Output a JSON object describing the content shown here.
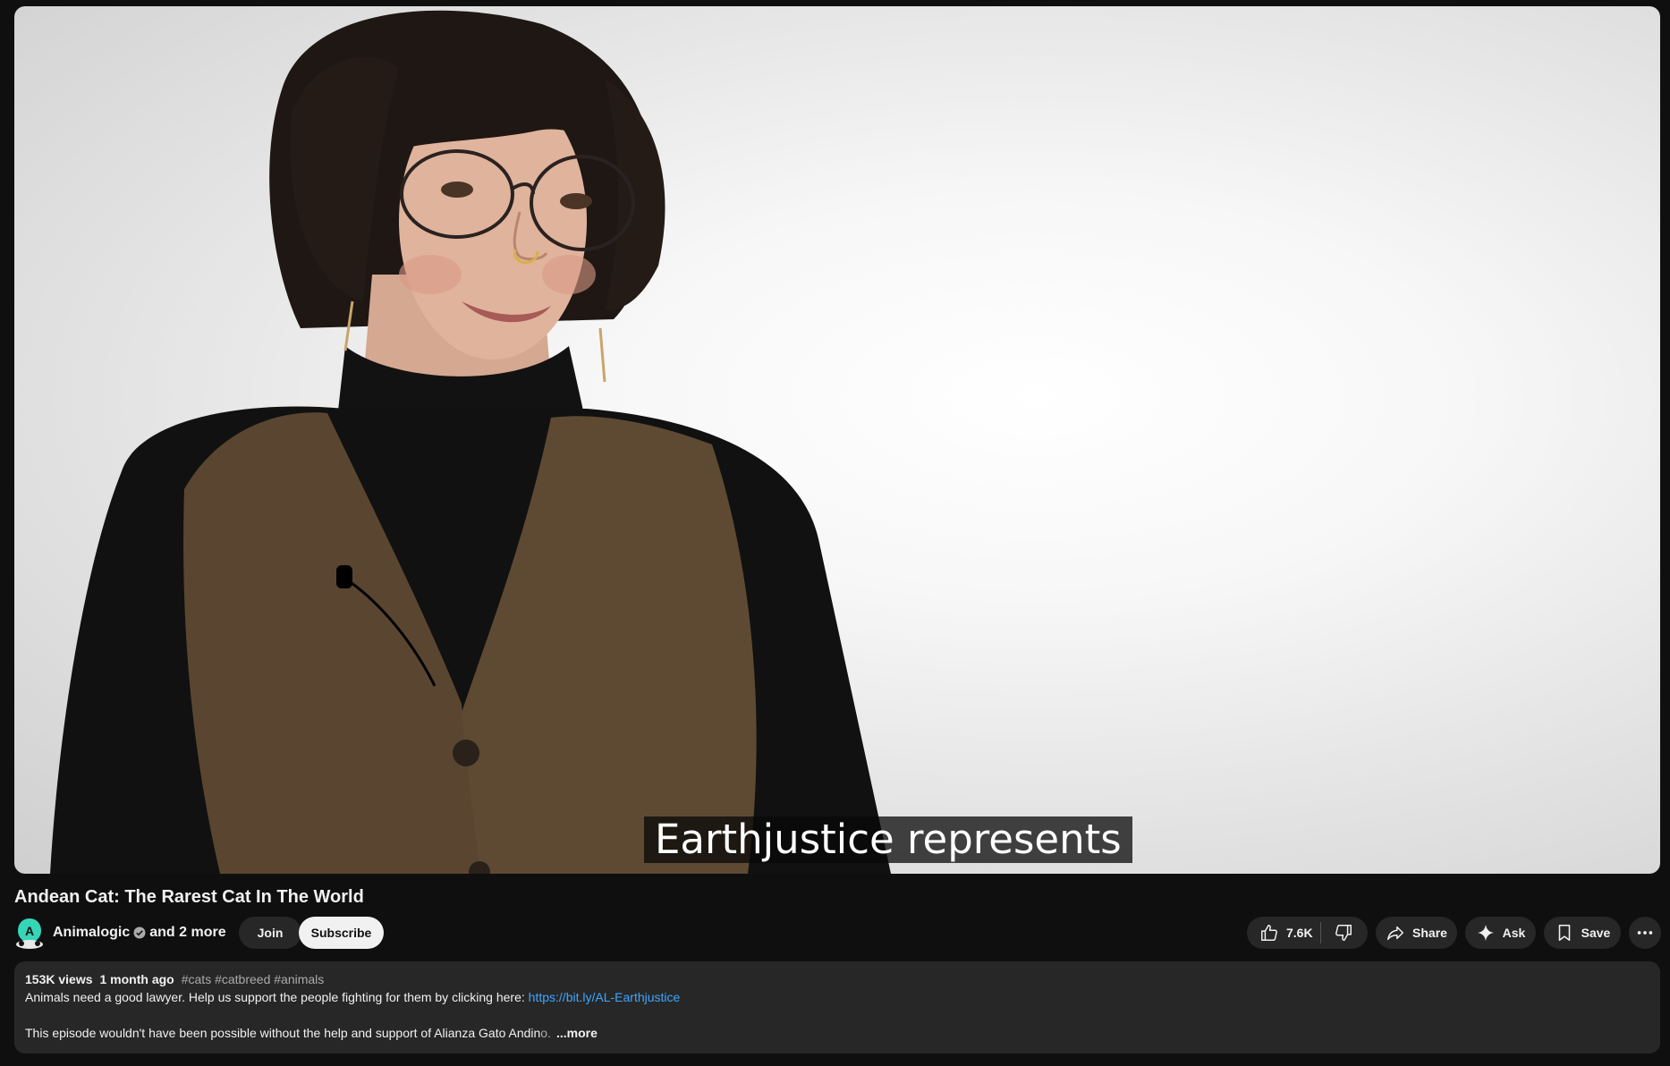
{
  "player": {
    "caption": "Earthjustice represents"
  },
  "video": {
    "title": "Andean Cat: The Rarest Cat In The World"
  },
  "owner": {
    "channel_name": "Animalogic",
    "collaborators": "and 2 more",
    "join_label": "Join",
    "subscribe_label": "Subscribe"
  },
  "actions": {
    "like_count": "7.6K",
    "share_label": "Share",
    "ask_label": "Ask",
    "save_label": "Save"
  },
  "description": {
    "views": "153K views",
    "date": "1 month ago",
    "hashtags": [
      "#cats",
      "#catbreed",
      "#animals"
    ],
    "line1_text": "Animals need a good lawyer. Help us support the people fighting for them by clicking here: ",
    "line1_link": "https://bit.ly/AL-Earthjustice",
    "line2_text": "This episode wouldn't have been possible without the help and support of Alianza Gato Andin",
    "line2_fade": "o.",
    "more_label": "...more"
  },
  "colors": {
    "background": "#0f0f0f",
    "button_bg": "#272727",
    "subscribe_bg": "#f1f1f1",
    "link": "#3ea6ff",
    "caption_bg": "#080808"
  },
  "icons": [
    "avatar-logo",
    "verified-icon",
    "thumb-up-icon",
    "thumb-down-icon",
    "share-icon",
    "sparkle-icon",
    "bookmark-icon",
    "more-horiz-icon"
  ]
}
